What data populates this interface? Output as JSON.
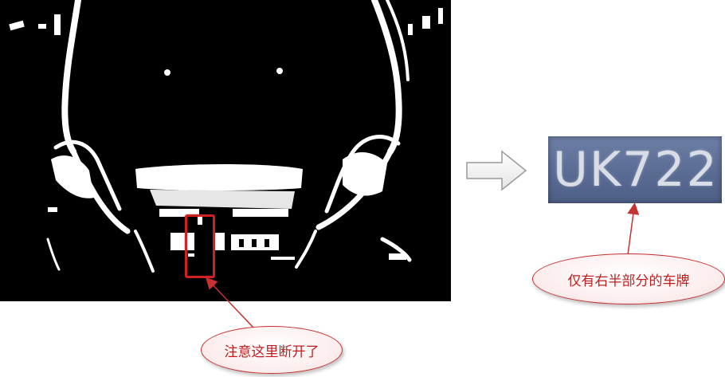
{
  "callouts": {
    "broken_note": "注意这里断开了",
    "plate_note": "仅有右半部分的车牌"
  },
  "plate": {
    "text": "UK722"
  },
  "colors": {
    "highlight_red": "#d21f1f",
    "arrow_red": "#c63131",
    "plate_blue": "#5a6c94"
  },
  "icons": {
    "transition": "right-arrow-icon"
  }
}
